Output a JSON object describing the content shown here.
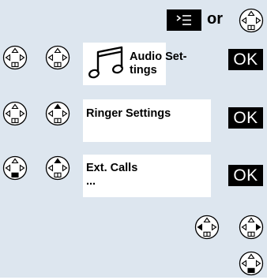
{
  "header": {
    "connector": "or",
    "menu_key_icon": "menu-key-icon",
    "nav_key_icon": "navigation-key-icon"
  },
  "steps": [
    {
      "display_icon": "music-note-icon",
      "display_text": "Audio Set-\ntings",
      "action": "OK"
    },
    {
      "display_text": "Ringer Settings",
      "action": "OK"
    },
    {
      "display_text": "Ext. Calls\n...",
      "action": "OK"
    }
  ],
  "colors": {
    "panel": "#dde6ef",
    "key_fill": "#ffffff",
    "key_highlight": "#000000",
    "badge": "#000000"
  }
}
